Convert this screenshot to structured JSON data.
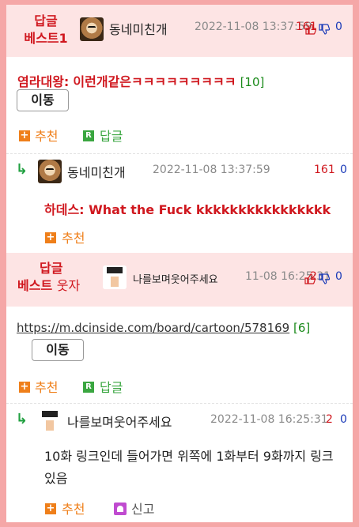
{
  "best1": {
    "tag_line1": "답글",
    "tag_line2": "베스트1",
    "nick": "동네미친개",
    "date": "2022-11-08 13:37:59",
    "up": "161",
    "down": "0"
  },
  "comment1": {
    "author": "염라대왕:",
    "text": "이런개같은ㅋㅋㅋㅋㅋㅋㅋㅋㅋ",
    "count": "[10]",
    "move_label": "이동",
    "recommend_label": "추천",
    "reply_label": "답글"
  },
  "reply1": {
    "arrow": "↳",
    "nick": "동네미친개",
    "date": "2022-11-08 13:37:59",
    "up": "161",
    "down": "0",
    "quote": "하데스: What the Fuck kkkkkkkkkkkkkkkk",
    "recommend_label": "추천"
  },
  "best2": {
    "tag_line1": "답글",
    "tag_line2": "베스트",
    "tag_extra": "웃자",
    "nick": "나를보며웃어주세요",
    "date": "11-08 16:25:31",
    "up": "2",
    "down": "0"
  },
  "comment2": {
    "link": "https://m.dcinside.com/board/cartoon/578169",
    "count": "[6]",
    "move_label": "이동",
    "recommend_label": "추천",
    "reply_label": "답글"
  },
  "reply2": {
    "arrow": "↳",
    "nick": "나를보며웃어주세요",
    "date": "2022-11-08 16:25:31",
    "up": "2",
    "down": "0",
    "text": "10화 링크인데 들어가면 위쪽에 1화부터 9화까지 링크 있음",
    "recommend_label": "추천",
    "report_label": "신고"
  },
  "icons": {
    "plus": "+",
    "reply_r": "R"
  },
  "colors": {
    "accent_red": "#d0181f",
    "accent_orange": "#ef7f1a",
    "accent_green": "#3aa640",
    "best_band": "#fde4e4",
    "border_pink": "#f5a7a7"
  }
}
